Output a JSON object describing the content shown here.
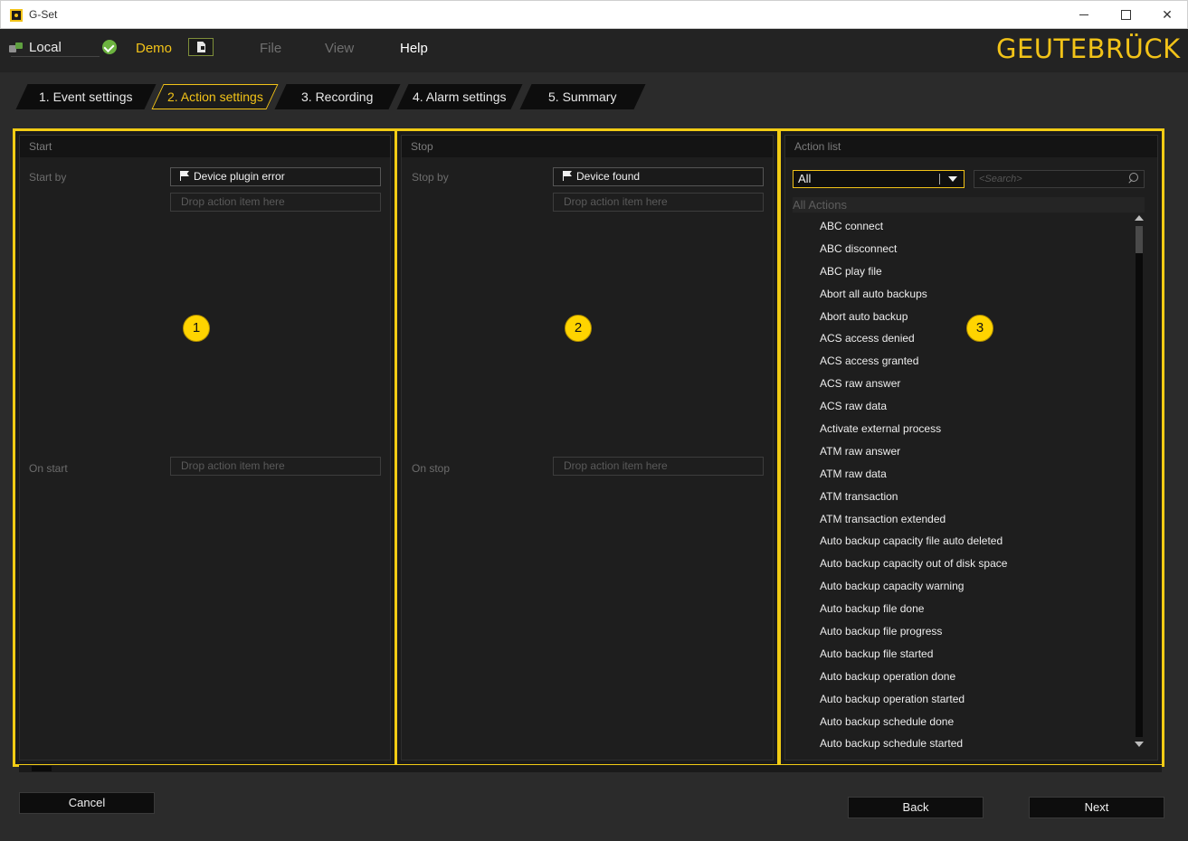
{
  "window": {
    "title": "G-Set"
  },
  "menu": {
    "local_label": "Local",
    "demo_label": "Demo",
    "file_label": "File",
    "view_label": "View",
    "help_label": "Help",
    "brand": "GEUTEBRÜCK"
  },
  "tabs": [
    {
      "label": "1. Event settings",
      "active": false
    },
    {
      "label": "2. Action settings",
      "active": true
    },
    {
      "label": "3. Recording",
      "active": false
    },
    {
      "label": "4. Alarm settings",
      "active": false
    },
    {
      "label": "5. Summary",
      "active": false
    }
  ],
  "start_panel": {
    "header": "Start",
    "start_by_label": "Start by",
    "start_by_item": "Device plugin error",
    "drop_placeholder": "Drop action item here",
    "on_start_label": "On start",
    "on_start_drop": "Drop action item here",
    "badge": "1"
  },
  "stop_panel": {
    "header": "Stop",
    "stop_by_label": "Stop by",
    "stop_by_item": "Device found",
    "drop_placeholder": "Drop action item here",
    "on_stop_label": "On stop",
    "on_stop_drop": "Drop action item here",
    "badge": "2"
  },
  "action_list": {
    "header": "Action list",
    "filter_value": "All",
    "search_placeholder": "<Search>",
    "group_header": "All Actions",
    "badge": "3",
    "items": [
      "ABC connect",
      "ABC disconnect",
      "ABC play file",
      "Abort all auto backups",
      "Abort auto backup",
      "ACS access denied",
      "ACS access granted",
      "ACS raw answer",
      "ACS raw data",
      "Activate external process",
      "ATM raw answer",
      "ATM raw data",
      "ATM transaction",
      "ATM transaction extended",
      "Auto backup capacity file auto deleted",
      "Auto backup capacity out of disk space",
      "Auto backup capacity warning",
      "Auto backup file done",
      "Auto backup file progress",
      "Auto backup file started",
      "Auto backup operation done",
      "Auto backup operation started",
      "Auto backup schedule done",
      "Auto backup schedule started"
    ]
  },
  "buttons": {
    "cancel": "Cancel",
    "back": "Back",
    "next": "Next"
  },
  "colors": {
    "accent": "#f2c318",
    "highlight_border": "#f2cc14",
    "background": "#2b2b2b"
  }
}
